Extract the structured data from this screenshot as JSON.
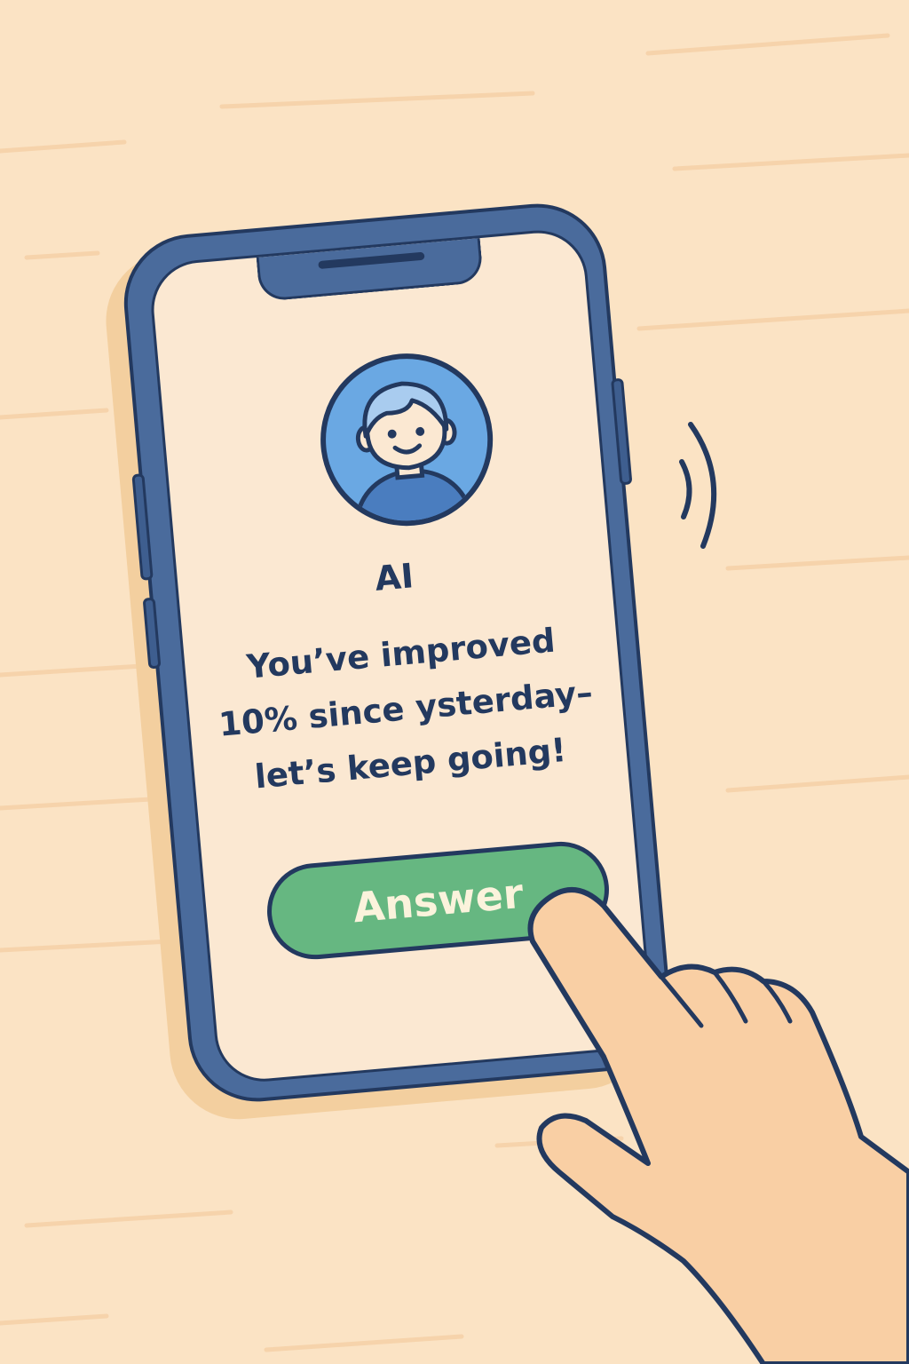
{
  "incoming_call": {
    "caller_name": "AI",
    "message_lines": [
      "You’ve improved",
      "10% since ysterday–",
      "let’s keep going!"
    ],
    "answer_label": "Answer"
  },
  "icons": {
    "avatar": "user-avatar-icon",
    "vibration": "vibration-waves-icon",
    "hand": "pointing-hand-icon"
  },
  "colors": {
    "background": "#fbe3c4",
    "phone_body": "#4a6b9c",
    "outline": "#23395f",
    "screen": "#fbe8d2",
    "answer_button": "#66b781",
    "avatar_circle": "#6aa8e3",
    "skin": "#f9cfa4"
  }
}
